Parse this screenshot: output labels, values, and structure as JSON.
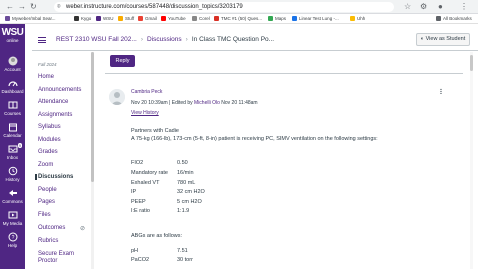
{
  "browser": {
    "url": "weber.instructure.com/courses/587448/discussion_topics/3203179",
    "bookmarks": [
      "Myweber/Inbal Sear...",
      "Kygo",
      "WSU",
      "Stuff",
      "Gmail",
      "YouTube",
      "Corel",
      "TMC #1 (50) Ques...",
      "Maps",
      "Linear Test Lung -...",
      "Uhh"
    ],
    "all_bookmarks": "All Bookmarks"
  },
  "global_nav": {
    "logo": "WSU",
    "logo_sub": "online",
    "items": [
      {
        "label": "Account",
        "icon": "account-icon"
      },
      {
        "label": "Dashboard",
        "icon": "dashboard-icon"
      },
      {
        "label": "Courses",
        "icon": "courses-icon"
      },
      {
        "label": "Calendar",
        "icon": "calendar-icon"
      },
      {
        "label": "Inbox",
        "icon": "inbox-icon",
        "badge": "9"
      },
      {
        "label": "History",
        "icon": "history-icon"
      },
      {
        "label": "Commons",
        "icon": "commons-icon"
      },
      {
        "label": "My Media",
        "icon": "media-icon"
      },
      {
        "label": "Help",
        "icon": "help-icon"
      }
    ]
  },
  "header": {
    "course": "REST 2310 WSU Fall 202...",
    "section": "Discussions",
    "page": "In Class TMC Question Po...",
    "view_as_student": "View as Student"
  },
  "course_nav": {
    "term": "Fall 2024",
    "items": [
      "Home",
      "Announcements",
      "Attendance",
      "Assignments",
      "Syllabus",
      "Modules",
      "Grades",
      "Zoom",
      "Discussions",
      "People",
      "Pages",
      "Files",
      "Outcomes",
      "Rubrics",
      "Secure Exam Proctor"
    ],
    "active": "Discussions"
  },
  "post": {
    "reply_label": "Reply",
    "author": "Cambria Peck",
    "date": "Nov 20 10:39am",
    "edited_by_prefix": "| Edited by",
    "editor": "Michelli Olo",
    "edited_date": "Nov 20 11:48am",
    "view_history": "View History",
    "partners": "Partners with Cadie",
    "scenario": "A 75-kg (166-lb), 173-cm (5-ft, 8-in) patient is receiving PC, SIMV ventilation on the following settings:",
    "settings": [
      {
        "k": "FIO2",
        "v": "0.50"
      },
      {
        "k": "Mandatory rate",
        "v": "16/min"
      },
      {
        "k": "Exhaled VT",
        "v": "780 mL"
      },
      {
        "k": "IP",
        "v": "32 cm H2O"
      },
      {
        "k": "PEEP",
        "v": "5 cm H2O"
      },
      {
        "k": "I:E ratio",
        "v": "1:1.9"
      }
    ],
    "abg_intro": "ABGs are as follows:",
    "abgs": [
      {
        "k": "pH",
        "v": "7.51"
      },
      {
        "k": "PaCO2",
        "v": "30 torr"
      }
    ]
  },
  "colors": {
    "brand": "#4f2683",
    "text": "#2d3b45"
  }
}
